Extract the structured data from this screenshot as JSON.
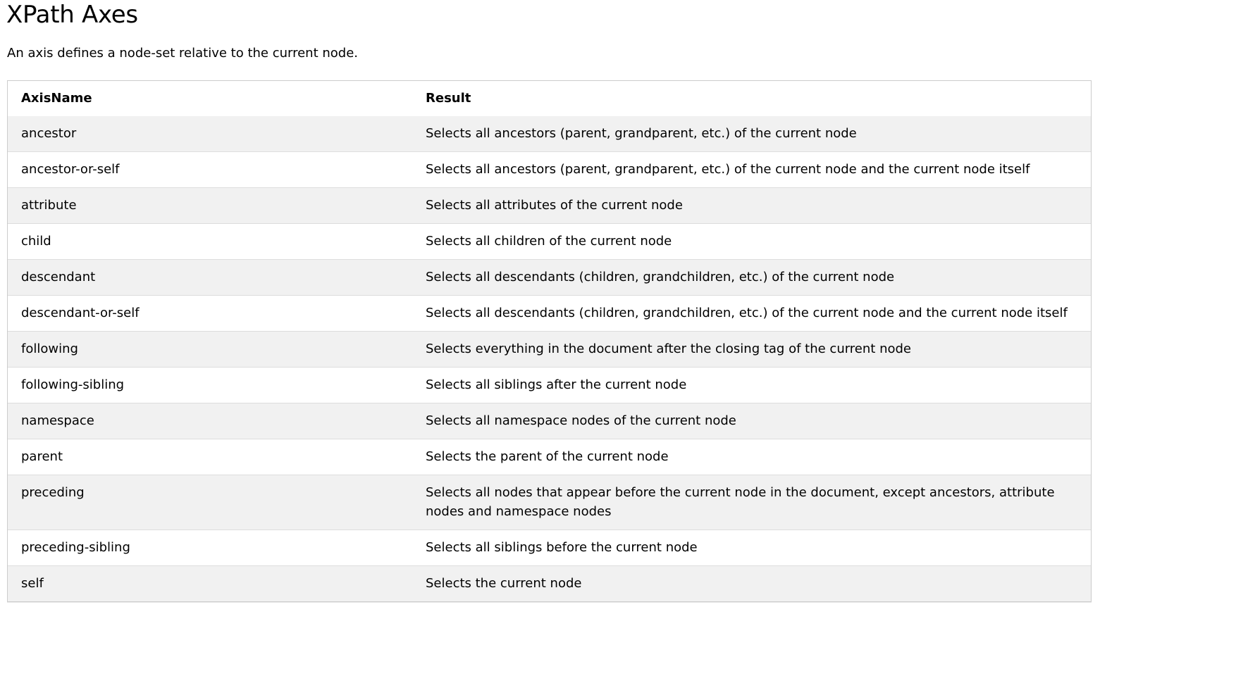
{
  "page": {
    "title": "XPath Axes",
    "intro": "An axis defines a node-set relative to the current node."
  },
  "table": {
    "headers": [
      "AxisName",
      "Result"
    ],
    "rows": [
      [
        "ancestor",
        "Selects all ancestors (parent, grandparent, etc.) of the current node"
      ],
      [
        "ancestor-or-self",
        "Selects all ancestors (parent, grandparent, etc.) of the current node and the current node itself"
      ],
      [
        "attribute",
        "Selects all attributes of the current node"
      ],
      [
        "child",
        "Selects all children of the current node"
      ],
      [
        "descendant",
        "Selects all descendants (children, grandchildren, etc.) of the current node"
      ],
      [
        "descendant-or-self",
        "Selects all descendants (children, grandchildren, etc.) of the current node and the current node itself"
      ],
      [
        "following",
        "Selects everything in the document after the closing tag of the current node"
      ],
      [
        "following-sibling",
        "Selects all siblings after the current node"
      ],
      [
        "namespace",
        "Selects all namespace nodes of the current node"
      ],
      [
        "parent",
        "Selects the parent of the current node"
      ],
      [
        "preceding",
        "Selects all nodes that appear before the current node in the document, except ancestors, attribute nodes and namespace nodes"
      ],
      [
        "preceding-sibling",
        "Selects all siblings before the current node"
      ],
      [
        "self",
        "Selects the current node"
      ]
    ]
  },
  "colors": {
    "row_stripe": "#f1f1f1",
    "row_plain": "#ffffff",
    "border": "#cccccc",
    "row_divider": "#dddddd"
  }
}
